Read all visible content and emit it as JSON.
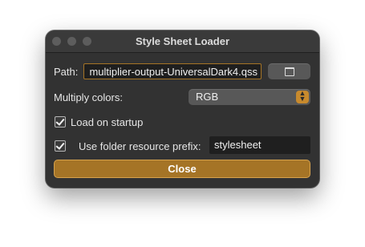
{
  "window": {
    "title": "Style Sheet Loader"
  },
  "path": {
    "label": "Path:",
    "value": "multiplier-output-UniversalDark4.qss",
    "browse_icon": "folder-icon"
  },
  "multiply": {
    "label": "Multiply colors:",
    "selected": "RGB",
    "arrows_icon": "chevron-up-down-icon"
  },
  "startup": {
    "label": "Load on startup",
    "checked": true
  },
  "prefix": {
    "label": "Use folder resource prefix:",
    "checked": true,
    "value": "stylesheet"
  },
  "close": {
    "label": "Close"
  },
  "colors": {
    "accent": "#a57426",
    "window_bg": "#323232",
    "field_bg": "#1f1f1f"
  }
}
